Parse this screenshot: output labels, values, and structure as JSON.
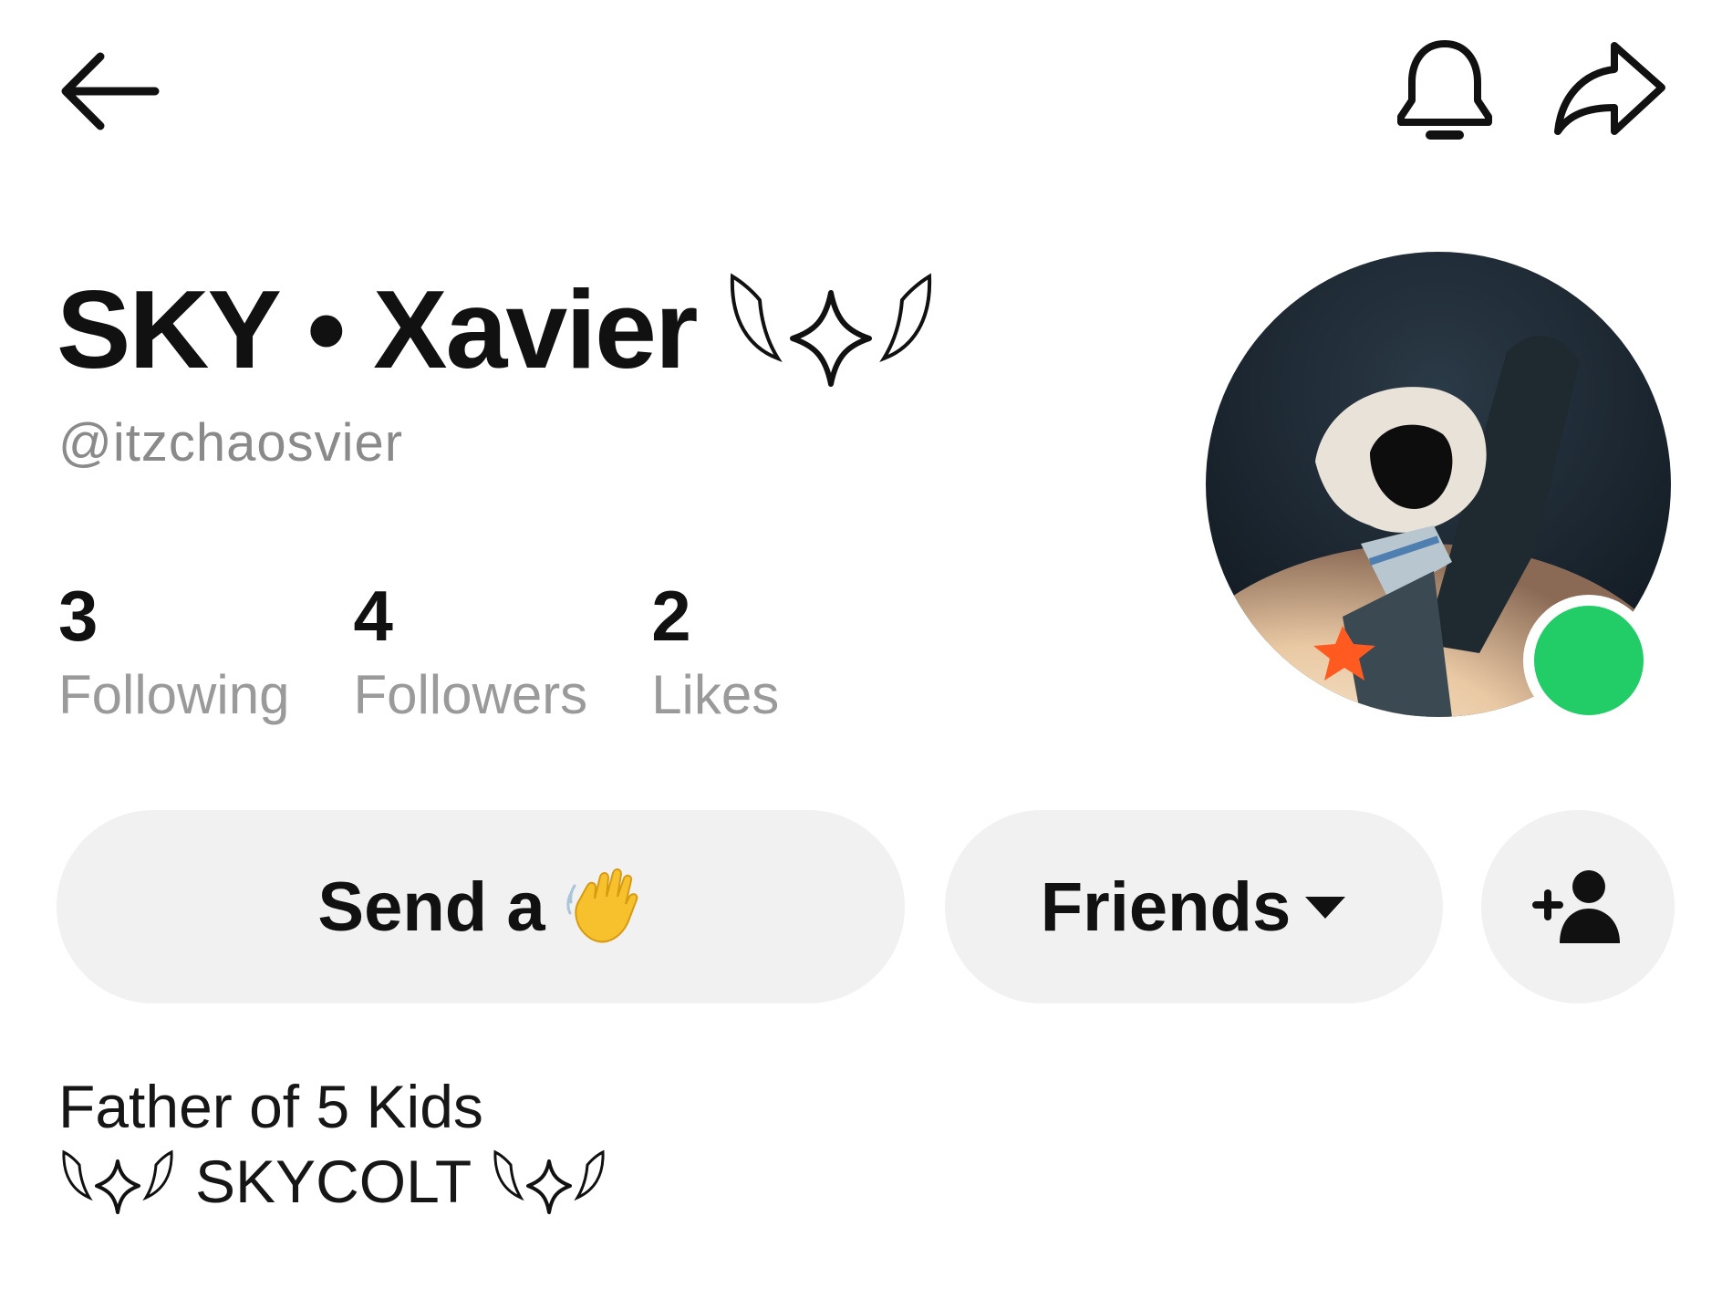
{
  "header": {
    "back_icon": "arrow-left-icon",
    "bell_icon": "bell-icon",
    "share_icon": "share-arrow-icon"
  },
  "profile": {
    "display_name": "SKY • Xavier",
    "name_decoration_icon": "winged-sparkle-icon",
    "username": "@itzchaosvier",
    "online": true,
    "online_color": "#22cc66",
    "avatar_icon": "sky-character-avatar"
  },
  "stats": [
    {
      "value": "3",
      "label": "Following"
    },
    {
      "value": "4",
      "label": "Followers"
    },
    {
      "value": "2",
      "label": "Likes"
    }
  ],
  "actions": {
    "wave_label": "Send a",
    "wave_emoji": "waving-hand-emoji",
    "friends_label": "Friends",
    "friends_caret_icon": "caret-down-icon",
    "add_friend_icon": "add-person-icon"
  },
  "bio": {
    "line1": "Father of 5 Kids",
    "line2": "SKYCOLT",
    "decoration_icon": "winged-sparkle-icon"
  },
  "colors": {
    "button_bg": "#f1f1f1",
    "secondary_text": "#9a9a9a"
  }
}
